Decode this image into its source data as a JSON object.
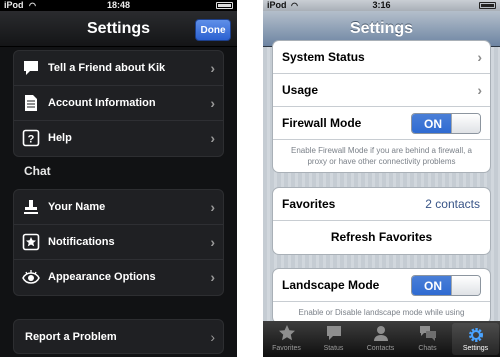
{
  "left": {
    "status": {
      "carrier": "iPod",
      "time": "18:48"
    },
    "nav": {
      "title": "Settings",
      "done_label": "Done"
    },
    "top_group": [
      {
        "label": "Tell a Friend about Kik",
        "icon": "speech-bubble-icon"
      },
      {
        "label": "Account Information",
        "icon": "document-icon"
      },
      {
        "label": "Help",
        "icon": "question-icon"
      }
    ],
    "chat_section_label": "Chat",
    "chat_group": [
      {
        "label": "Your Name",
        "icon": "stamp-icon"
      },
      {
        "label": "Notifications",
        "icon": "star-icon"
      },
      {
        "label": "Appearance Options",
        "icon": "eye-icon"
      }
    ],
    "report_label": "Report a Problem"
  },
  "right": {
    "status": {
      "carrier": "iPod",
      "time": "3:16"
    },
    "nav": {
      "title": "Settings"
    },
    "group1": {
      "system_status": "System Status",
      "usage": "Usage",
      "firewall_mode": "Firewall Mode",
      "firewall_toggle": "ON",
      "firewall_note": "Enable Firewall Mode if you are behind a firewall, a proxy or have other connectivity problems"
    },
    "group2": {
      "favorites": "Favorites",
      "favorites_value": "2 contacts",
      "refresh": "Refresh Favorites"
    },
    "group3": {
      "landscape_mode": "Landscape Mode",
      "landscape_toggle": "ON",
      "landscape_note": "Enable or Disable landscape mode while using"
    },
    "tabs": [
      {
        "label": "Favorites",
        "icon": "star-icon"
      },
      {
        "label": "Status",
        "icon": "speech-bubble-icon"
      },
      {
        "label": "Contacts",
        "icon": "person-icon"
      },
      {
        "label": "Chats",
        "icon": "chats-icon"
      },
      {
        "label": "Settings",
        "icon": "gear-icon",
        "active": true
      }
    ],
    "colors": {
      "toggle_on": "#2f6bd2",
      "value_text": "#385487"
    }
  }
}
